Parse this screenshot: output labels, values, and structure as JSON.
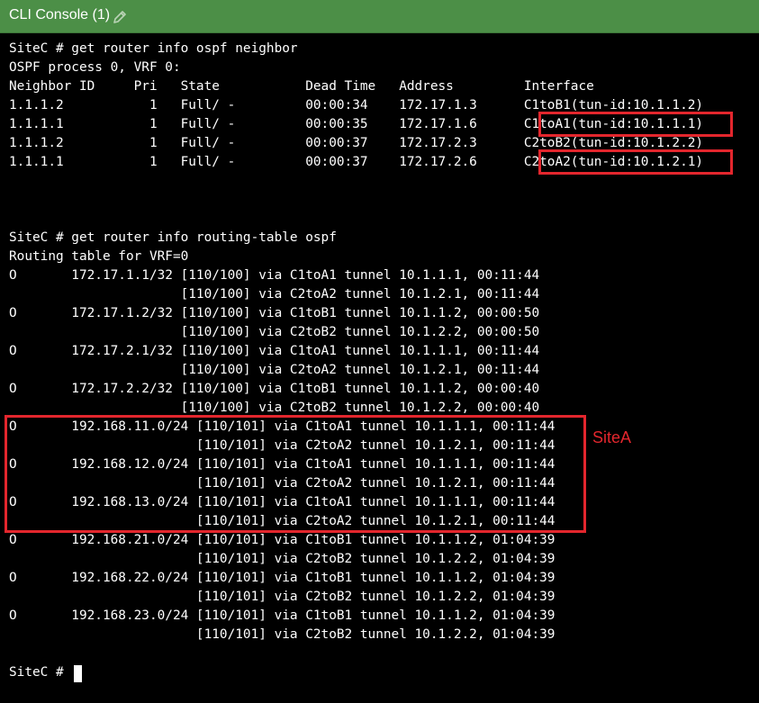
{
  "window": {
    "title": "CLI Console (1)",
    "edit_icon": "pencil-icon"
  },
  "console": {
    "lines": [
      "SiteC # get router info ospf neighbor",
      "OSPF process 0, VRF 0:",
      "Neighbor ID     Pri   State           Dead Time   Address         Interface",
      "1.1.1.2           1   Full/ -         00:00:34    172.17.1.3      C1toB1(tun-id:10.1.1.2)",
      "1.1.1.1           1   Full/ -         00:00:35    172.17.1.6      C1toA1(tun-id:10.1.1.1)",
      "1.1.1.2           1   Full/ -         00:00:37    172.17.2.3      C2toB2(tun-id:10.1.2.2)",
      "1.1.1.1           1   Full/ -         00:00:37    172.17.2.6      C2toA2(tun-id:10.1.2.1)",
      "",
      "",
      "",
      "SiteC # get router info routing-table ospf",
      "Routing table for VRF=0",
      "O       172.17.1.1/32 [110/100] via C1toA1 tunnel 10.1.1.1, 00:11:44",
      "                      [110/100] via C2toA2 tunnel 10.1.2.1, 00:11:44",
      "O       172.17.1.2/32 [110/100] via C1toB1 tunnel 10.1.1.2, 00:00:50",
      "                      [110/100] via C2toB2 tunnel 10.1.2.2, 00:00:50",
      "O       172.17.2.1/32 [110/100] via C1toA1 tunnel 10.1.1.1, 00:11:44",
      "                      [110/100] via C2toA2 tunnel 10.1.2.1, 00:11:44",
      "O       172.17.2.2/32 [110/100] via C1toB1 tunnel 10.1.1.2, 00:00:40",
      "                      [110/100] via C2toB2 tunnel 10.1.2.2, 00:00:40",
      "O       192.168.11.0/24 [110/101] via C1toA1 tunnel 10.1.1.1, 00:11:44",
      "                        [110/101] via C2toA2 tunnel 10.1.2.1, 00:11:44",
      "O       192.168.12.0/24 [110/101] via C1toA1 tunnel 10.1.1.1, 00:11:44",
      "                        [110/101] via C2toA2 tunnel 10.1.2.1, 00:11:44",
      "O       192.168.13.0/24 [110/101] via C1toA1 tunnel 10.1.1.1, 00:11:44",
      "                        [110/101] via C2toA2 tunnel 10.1.2.1, 00:11:44",
      "O       192.168.21.0/24 [110/101] via C1toB1 tunnel 10.1.1.2, 01:04:39",
      "                        [110/101] via C2toB2 tunnel 10.1.2.2, 01:04:39",
      "O       192.168.22.0/24 [110/101] via C1toB1 tunnel 10.1.1.2, 01:04:39",
      "                        [110/101] via C2toB2 tunnel 10.1.2.2, 01:04:39",
      "O       192.168.23.0/24 [110/101] via C1toB1 tunnel 10.1.1.2, 01:04:39",
      "                        [110/101] via C2toB2 tunnel 10.1.2.2, 01:04:39",
      "",
      "SiteC # "
    ]
  },
  "annotations": {
    "site_label": "SiteA",
    "highlight_color": "#e3262d"
  },
  "colors": {
    "titlebar": "#4c8f47",
    "console_bg": "#000000",
    "console_text": "#ffffff"
  }
}
